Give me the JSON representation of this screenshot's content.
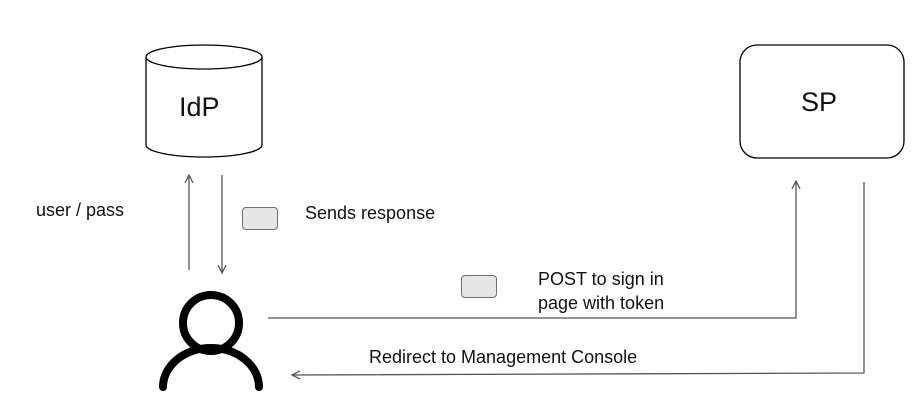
{
  "nodes": {
    "idp": {
      "label": "IdP"
    },
    "sp": {
      "label": "SP"
    },
    "user": {
      "icon": "user-icon"
    }
  },
  "edges": {
    "user_to_idp": {
      "label": "user / pass"
    },
    "idp_to_user": {
      "label": "Sends response"
    },
    "user_to_sp": {
      "label_line1": "POST to sign in",
      "label_line2": "page with token"
    },
    "sp_to_user": {
      "label": "Redirect to Management Console"
    }
  },
  "colors": {
    "stroke": "#000000",
    "arrow": "#555555",
    "chip_fill": "#e6e6e6",
    "chip_border": "#6f6f6f"
  }
}
